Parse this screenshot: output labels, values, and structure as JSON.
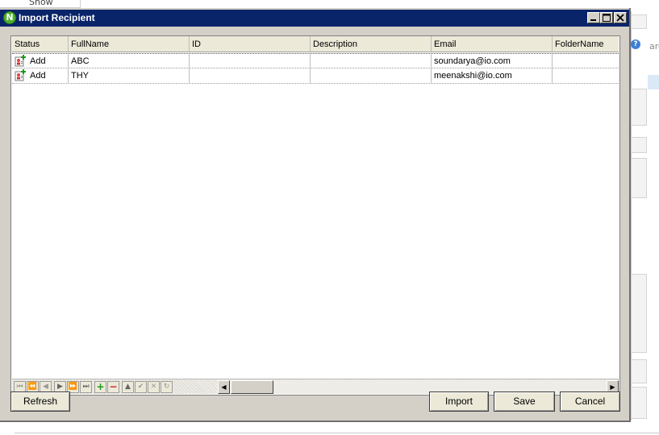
{
  "background": {
    "show_label": "Show",
    "search_fragment": "arc"
  },
  "dialog": {
    "title": "Import Recipient",
    "app_icon_letter": "N",
    "title_buttons": [
      "minimize-icon",
      "maximize-icon",
      "close-icon"
    ]
  },
  "grid": {
    "columns": [
      "Status",
      "FullName",
      "ID",
      "Description",
      "Email",
      "FolderName"
    ],
    "rows": [
      {
        "status": "Add",
        "full_name": "ABC",
        "id": "",
        "description": "",
        "email": "soundarya@io.com",
        "folder_name": ""
      },
      {
        "status": "Add",
        "full_name": "THY",
        "id": "",
        "description": "",
        "email": "meenakshi@io.com",
        "folder_name": ""
      }
    ],
    "nav_buttons": [
      "first-icon",
      "prev-page-icon",
      "prev-icon",
      "next-icon",
      "next-page-icon",
      "last-icon",
      "add-icon",
      "remove-icon",
      "up-icon",
      "accept-icon",
      "cancel-edit-icon",
      "refresh-icon"
    ]
  },
  "buttons": {
    "refresh": "Refresh",
    "import": "Import",
    "save": "Save",
    "cancel": "Cancel"
  },
  "colors": {
    "titlebar": "#0a246a",
    "dialog_bg": "#d4d0c8",
    "add_green": "#1c9a1c",
    "remove_red": "#d21f1f"
  }
}
